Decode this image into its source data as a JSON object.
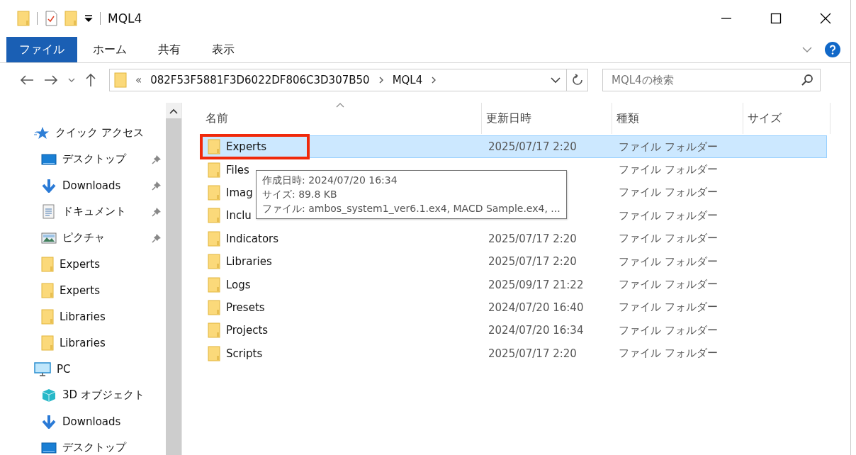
{
  "window": {
    "title": "MQL4"
  },
  "ribbon_tabs": [
    {
      "label": "ファイル",
      "selected": true
    },
    {
      "label": "ホーム",
      "selected": false
    },
    {
      "label": "共有",
      "selected": false
    },
    {
      "label": "表示",
      "selected": false
    }
  ],
  "address_bar": {
    "overflow": "«",
    "segments": [
      "082F53F5881F3D6022DF806C3D307B50",
      "MQL4"
    ]
  },
  "search": {
    "placeholder": "MQL4の検索"
  },
  "navigation": [
    {
      "label": "クイック アクセス",
      "kind": "star",
      "items": [
        {
          "label": "デスクトップ",
          "kind": "desktop",
          "pinned": true
        },
        {
          "label": "Downloads",
          "kind": "download",
          "pinned": true
        },
        {
          "label": "ドキュメント",
          "kind": "document",
          "pinned": true
        },
        {
          "label": "ピクチャ",
          "kind": "picture",
          "pinned": true
        },
        {
          "label": "Experts",
          "kind": "folder",
          "pinned": false
        },
        {
          "label": "Experts",
          "kind": "folder",
          "pinned": false
        },
        {
          "label": "Libraries",
          "kind": "folder",
          "pinned": false
        },
        {
          "label": "Libraries",
          "kind": "folder",
          "pinned": false
        }
      ]
    },
    {
      "label": "PC",
      "kind": "pc",
      "items": [
        {
          "label": "3D オブジェクト",
          "kind": "cube",
          "pinned": false
        },
        {
          "label": "Downloads",
          "kind": "download",
          "pinned": false
        },
        {
          "label": "デスクトップ",
          "kind": "desktop",
          "pinned": false
        }
      ]
    }
  ],
  "table": {
    "columns": [
      {
        "label": "名前",
        "sorted": true
      },
      {
        "label": "更新日時",
        "sorted": false
      },
      {
        "label": "種類",
        "sorted": false
      },
      {
        "label": "サイズ",
        "sorted": false
      }
    ],
    "rows": [
      {
        "name": "Experts",
        "modified": "2025/07/17 2:20",
        "type": "ファイル フォルダー",
        "selected": true,
        "highlighted": true
      },
      {
        "name": "Files",
        "type": "ファイル フォルダー",
        "selected": false,
        "highlighted": false
      },
      {
        "name": "Imag",
        "type": "ファイル フォルダー",
        "selected": false,
        "highlighted": false
      },
      {
        "name": "Inclu",
        "type": "ファイル フォルダー",
        "selected": false,
        "highlighted": false
      },
      {
        "name": "Indicators",
        "modified": "2025/07/17 2:20",
        "type": "ファイル フォルダー",
        "selected": false,
        "highlighted": false
      },
      {
        "name": "Libraries",
        "modified": "2025/07/17 2:20",
        "type": "ファイル フォルダー",
        "selected": false,
        "highlighted": false
      },
      {
        "name": "Logs",
        "modified": "2025/09/17 21:22",
        "type": "ファイル フォルダー",
        "selected": false,
        "highlighted": false
      },
      {
        "name": "Presets",
        "modified": "2024/07/20 16:40",
        "type": "ファイル フォルダー",
        "selected": false,
        "highlighted": false
      },
      {
        "name": "Projects",
        "modified": "2024/07/20 16:34",
        "type": "ファイル フォルダー",
        "selected": false,
        "highlighted": false
      },
      {
        "name": "Scripts",
        "modified": "2025/07/17 2:20",
        "type": "ファイル フォルダー",
        "selected": false,
        "highlighted": false
      }
    ]
  },
  "tooltip": {
    "lines": [
      "作成日時: 2024/07/20 16:34",
      "サイズ: 89.8 KB",
      "ファイル: ambos_system1_ver6.1.ex4, MACD Sample.ex4, ..."
    ]
  }
}
